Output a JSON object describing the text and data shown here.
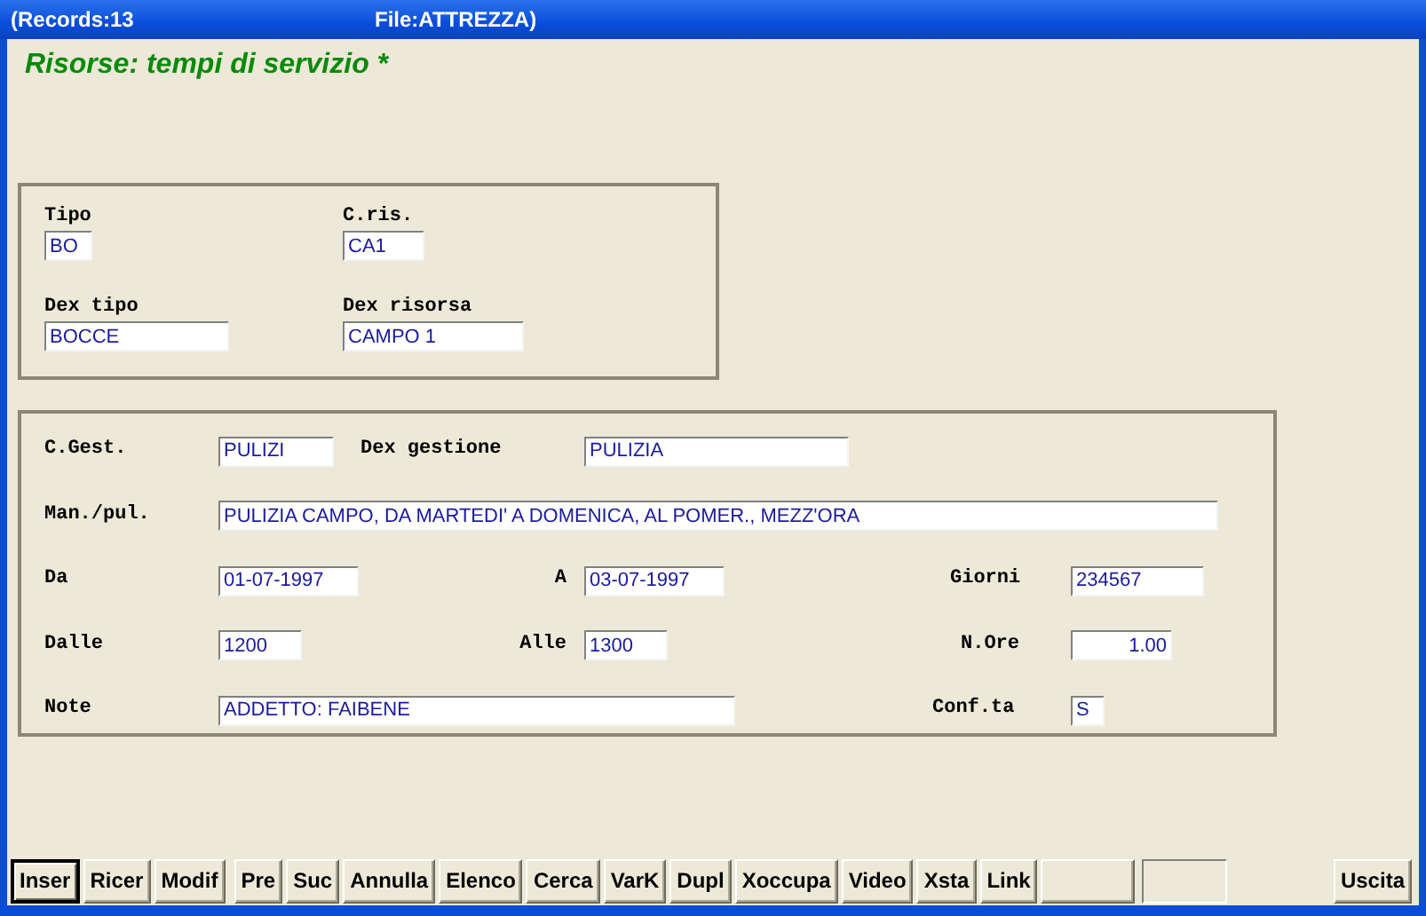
{
  "window": {
    "records": "(Records:13",
    "file": "File:ATTREZZA)"
  },
  "heading": "Risorse: tempi di servizio *",
  "resource": {
    "tipo": {
      "label": "Tipo",
      "value": "BO"
    },
    "c_ris": {
      "label": "C.ris.",
      "value": "CA1"
    },
    "dex_tipo": {
      "label": "Dex tipo",
      "value": "BOCCE"
    },
    "dex_risorsa": {
      "label": "Dex risorsa",
      "value": "CAMPO 1"
    }
  },
  "service": {
    "c_gest": {
      "label": "C.Gest.",
      "value": "PULIZI"
    },
    "dex_gestione": {
      "label": "Dex gestione",
      "value": "PULIZIA"
    },
    "man_pul": {
      "label": "Man./pul.",
      "value": "PULIZIA CAMPO, DA MARTEDI' A DOMENICA, AL POMER., MEZZ'ORA"
    },
    "da": {
      "label": "Da",
      "value": "01-07-1997"
    },
    "a": {
      "label": "A",
      "value": "03-07-1997"
    },
    "giorni": {
      "label": "Giorni",
      "value": "234567"
    },
    "dalle": {
      "label": "Dalle",
      "value": "1200"
    },
    "alle": {
      "label": "Alle",
      "value": "1300"
    },
    "n_ore": {
      "label": "N.Ore",
      "value": "1.00"
    },
    "note": {
      "label": "Note",
      "value": "ADDETTO: FAIBENE"
    },
    "conf_ta": {
      "label": "Conf.ta",
      "value": "S"
    }
  },
  "buttons": [
    {
      "kind": "button",
      "label": "Inser",
      "selected": true
    },
    {
      "kind": "button",
      "label": "Ricer",
      "selected": false
    },
    {
      "kind": "button",
      "label": "Modif",
      "selected": false
    },
    {
      "kind": "button",
      "label": "Pre",
      "selected": false
    },
    {
      "kind": "button",
      "label": "Suc",
      "selected": false
    },
    {
      "kind": "button",
      "label": "Annulla",
      "selected": false
    },
    {
      "kind": "button",
      "label": "Elenco",
      "selected": false
    },
    {
      "kind": "button",
      "label": "Cerca",
      "selected": false
    },
    {
      "kind": "button",
      "label": "VarK",
      "selected": false
    },
    {
      "kind": "button",
      "label": "Dupl",
      "selected": false
    },
    {
      "kind": "button",
      "label": "Xoccupa",
      "selected": false
    },
    {
      "kind": "button",
      "label": "Video",
      "selected": false
    },
    {
      "kind": "button",
      "label": "Xsta",
      "selected": false
    },
    {
      "kind": "button",
      "label": "Link",
      "selected": false
    },
    {
      "kind": "blank",
      "selected": false
    },
    {
      "kind": "panel"
    },
    {
      "kind": "button",
      "label": "Uscita",
      "selected": false
    }
  ]
}
